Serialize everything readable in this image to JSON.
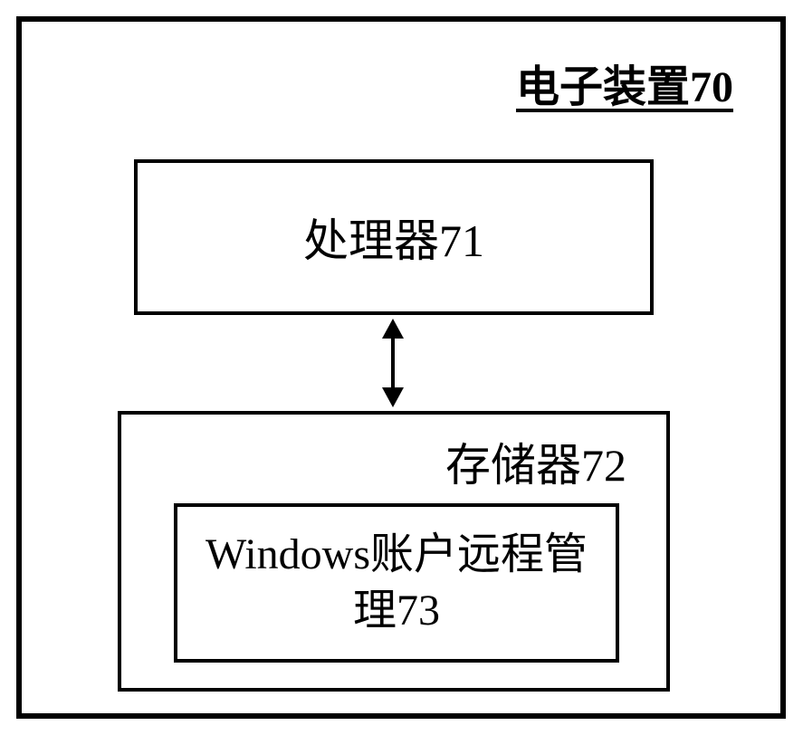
{
  "diagram": {
    "title": "电子装置70",
    "processor": {
      "label": "处理器71"
    },
    "memory": {
      "label": "存储器72",
      "module": {
        "label": "Windows账户远程管理73"
      }
    }
  }
}
